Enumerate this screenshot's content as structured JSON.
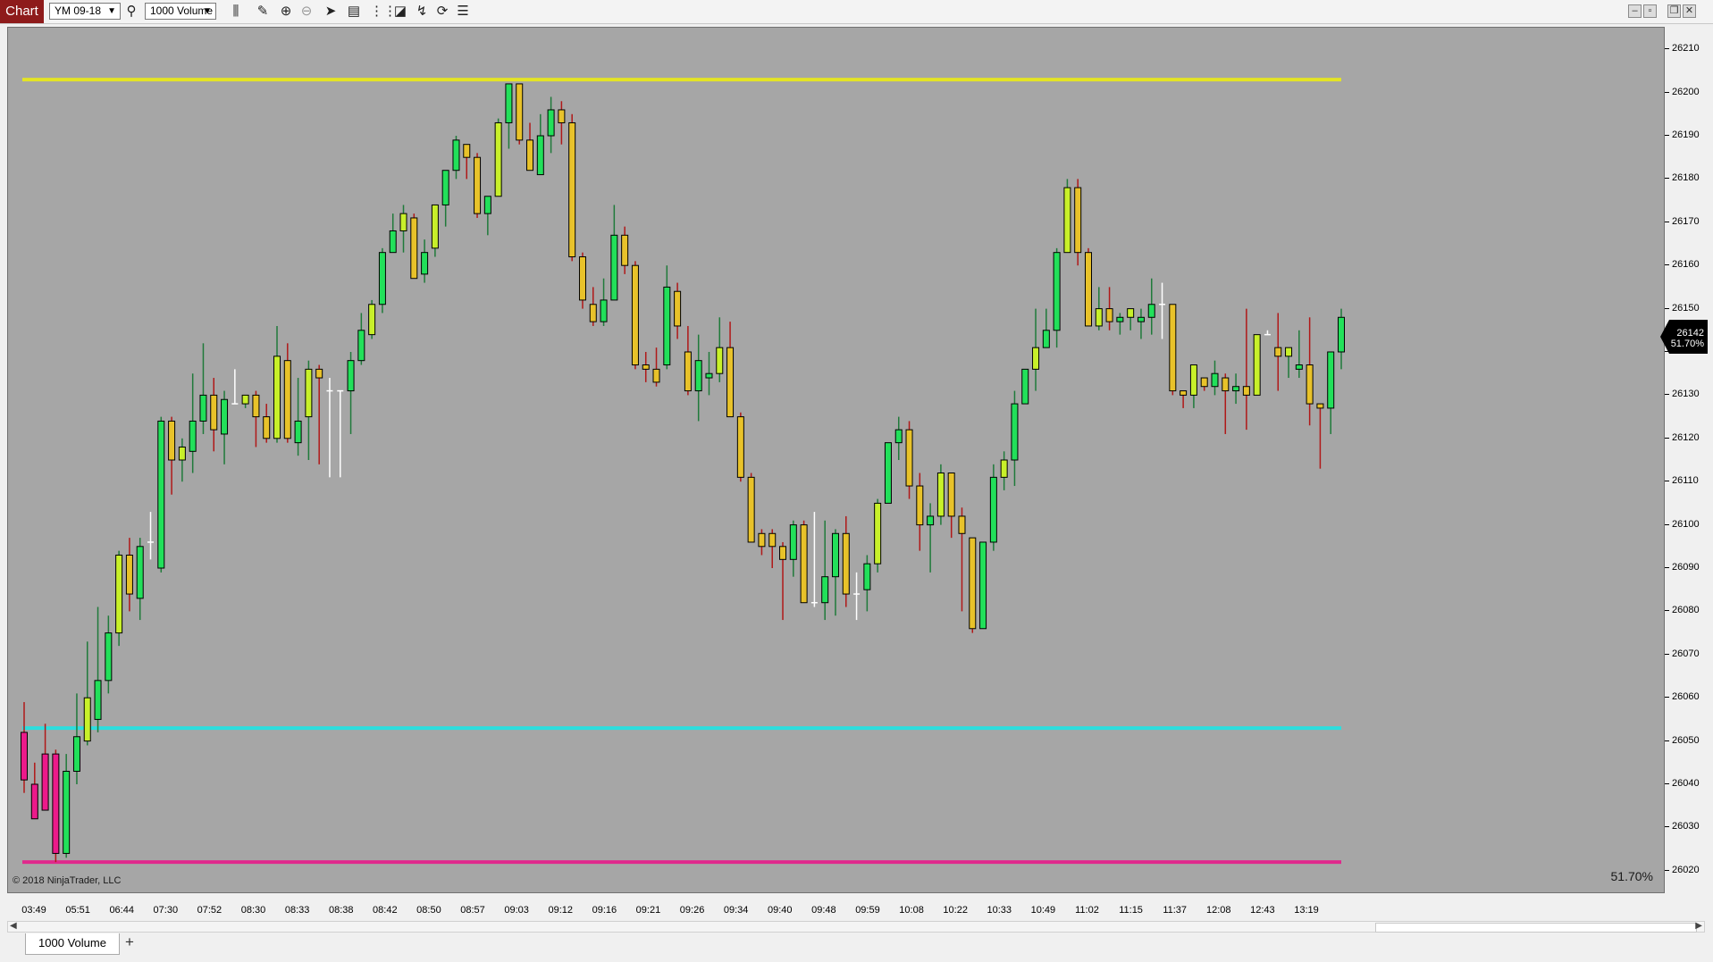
{
  "toolbar": {
    "chart_label": "Chart",
    "instrument": "YM 09-18",
    "period": "1000 Volume",
    "icons": [
      "magnify-icon",
      "bar-type-icon",
      "pencil-icon",
      "zoom-in-icon",
      "zoom-out-icon",
      "pointer-icon",
      "properties-icon",
      "columns-icon",
      "data-box-icon",
      "strategies-icon",
      "indicators-icon",
      "chart-trader-icon"
    ],
    "window_buttons": [
      "minimize-icon",
      "restore-icon",
      "maximize-icon",
      "close-icon"
    ]
  },
  "chart": {
    "copyright": "© 2018 NinjaTrader, LLC",
    "percent_label": "51.70%",
    "last_price": "26142",
    "last_percent": "51.70%",
    "colors": {
      "background": "#a6a6a6",
      "up_body": "#22e05a",
      "up_body_alt": "#c8f02a",
      "down_body": "#e8c22a",
      "down_body_alt": "#ec1a8a",
      "outline": "#000000",
      "wick_up": "#1f7a3a",
      "wick_down": "#b01818",
      "doji": "#ffffff",
      "resistance_line": "#e4e424",
      "support_line_1": "#2cdede",
      "support_line_2": "#e0288c"
    }
  },
  "chart_data": {
    "type": "candlestick",
    "ylim": [
      26015,
      26215
    ],
    "y_ticks": [
      26210,
      26200,
      26190,
      26180,
      26170,
      26160,
      26150,
      26140,
      26130,
      26120,
      26110,
      26100,
      26090,
      26080,
      26070,
      26060,
      26050,
      26040,
      26030,
      26020
    ],
    "x_ticks": [
      "03:49",
      "05:51",
      "06:44",
      "07:30",
      "07:52",
      "08:30",
      "08:33",
      "08:38",
      "08:42",
      "08:50",
      "08:57",
      "09:03",
      "09:12",
      "09:16",
      "09:21",
      "09:26",
      "09:34",
      "09:40",
      "09:48",
      "09:59",
      "10:08",
      "10:22",
      "10:33",
      "10:49",
      "11:02",
      "11:15",
      "11:37",
      "12:08",
      "12:43",
      "13:19"
    ],
    "horizontal_lines": [
      {
        "price": 26203,
        "color": "#e4e424"
      },
      {
        "price": 26053,
        "color": "#2cdede"
      },
      {
        "price": 26022,
        "color": "#e0288c"
      }
    ],
    "ohlc": [
      [
        26052,
        26059,
        26038,
        26041
      ],
      [
        26040,
        26045,
        26033,
        26032
      ],
      [
        26047,
        26054,
        26034,
        26034
      ],
      [
        26047,
        26048,
        26022,
        26024
      ],
      [
        26024,
        26047,
        26023,
        26043
      ],
      [
        26043,
        26061,
        26040,
        26051
      ],
      [
        26050,
        26073,
        26049,
        26060
      ],
      [
        26055,
        26081,
        26052,
        26064
      ],
      [
        26064,
        26079,
        26061,
        26075
      ],
      [
        26075,
        26094,
        26072,
        26093
      ],
      [
        26093,
        26097,
        26080,
        26084
      ],
      [
        26083,
        26097,
        26078,
        26095
      ],
      [
        26096,
        26103,
        26092,
        26096
      ],
      [
        26090,
        26125,
        26089,
        26124
      ],
      [
        26124,
        26125,
        26107,
        26115
      ],
      [
        26115,
        26120,
        26110,
        26118
      ],
      [
        26117,
        26135,
        26112,
        26124
      ],
      [
        26124,
        26142,
        26121,
        26130
      ],
      [
        26130,
        26134,
        26117,
        26122
      ],
      [
        26121,
        26131,
        26114,
        26129
      ],
      [
        26128,
        26136,
        26128,
        26128
      ],
      [
        26128,
        26129,
        26127,
        26130
      ],
      [
        26130,
        26131,
        26118,
        26125
      ],
      [
        26125,
        26128,
        26119,
        26120
      ],
      [
        26120,
        26146,
        26119,
        26139
      ],
      [
        26138,
        26142,
        26119,
        26120
      ],
      [
        26119,
        26134,
        26116,
        26124
      ],
      [
        26125,
        26138,
        26115,
        26136
      ],
      [
        26136,
        26137,
        26114,
        26134
      ],
      [
        26131,
        26134,
        26111,
        26131
      ],
      [
        26131,
        26131,
        26111,
        26131
      ],
      [
        26131,
        26140,
        26121,
        26138
      ],
      [
        26138,
        26149,
        26137,
        26145
      ],
      [
        26144,
        26152,
        26143,
        26151
      ],
      [
        26151,
        26164,
        26149,
        26163
      ],
      [
        26163,
        26172,
        26167,
        26168
      ],
      [
        26168,
        26174,
        26163,
        26172
      ],
      [
        26171,
        26172,
        26157,
        26157
      ],
      [
        26158,
        26166,
        26156,
        26163
      ],
      [
        26164,
        26174,
        26162,
        26174
      ],
      [
        26174,
        26180,
        26169,
        26182
      ],
      [
        26182,
        26190,
        26180,
        26189
      ],
      [
        26188,
        26188,
        26180,
        26185
      ],
      [
        26185,
        26186,
        26171,
        26172
      ],
      [
        26172,
        26176,
        26167,
        26176
      ],
      [
        26176,
        26194,
        26177,
        26193
      ],
      [
        26193,
        26202,
        26187,
        26202
      ],
      [
        26202,
        26202,
        26188,
        26189
      ],
      [
        26189,
        26193,
        26182,
        26182
      ],
      [
        26181,
        26195,
        26181,
        26190
      ],
      [
        26190,
        26199,
        26186,
        26196
      ],
      [
        26196,
        26198,
        26188,
        26193
      ],
      [
        26193,
        26195,
        26161,
        26162
      ],
      [
        26162,
        26163,
        26150,
        26152
      ],
      [
        26151,
        26155,
        26146,
        26147
      ],
      [
        26147,
        26157,
        26146,
        26152
      ],
      [
        26152,
        26174,
        26152,
        26167
      ],
      [
        26167,
        26169,
        26158,
        26160
      ],
      [
        26160,
        26161,
        26136,
        26137
      ],
      [
        26137,
        26140,
        26133,
        26136
      ],
      [
        26136,
        26141,
        26132,
        26133
      ],
      [
        26137,
        26160,
        26136,
        26155
      ],
      [
        26154,
        26156,
        26143,
        26146
      ],
      [
        26140,
        26146,
        26130,
        26131
      ],
      [
        26131,
        26144,
        26124,
        26138
      ],
      [
        26134,
        26140,
        26130,
        26135
      ],
      [
        26135,
        26148,
        26133,
        26141
      ],
      [
        26141,
        26147,
        26125,
        26125
      ],
      [
        26125,
        26126,
        26110,
        26111
      ],
      [
        26111,
        26112,
        26096,
        26096
      ],
      [
        26098,
        26099,
        26093,
        26095
      ],
      [
        26098,
        26099,
        26090,
        26095
      ],
      [
        26095,
        26096,
        26078,
        26092
      ],
      [
        26092,
        26101,
        26088,
        26100
      ],
      [
        26100,
        26101,
        26084,
        26082
      ],
      [
        26082,
        26103,
        26081,
        26082
      ],
      [
        26082,
        26101,
        26078,
        26088
      ],
      [
        26088,
        26099,
        26079,
        26098
      ],
      [
        26098,
        26102,
        26081,
        26084
      ],
      [
        26084,
        26089,
        26078,
        26084
      ],
      [
        26085,
        26093,
        26080,
        26091
      ],
      [
        26091,
        26106,
        26089,
        26105
      ],
      [
        26105,
        26119,
        26105,
        26119
      ],
      [
        26119,
        26125,
        26115,
        26122
      ],
      [
        26122,
        26124,
        26106,
        26109
      ],
      [
        26109,
        26112,
        26094,
        26100
      ],
      [
        26100,
        26105,
        26089,
        26102
      ],
      [
        26102,
        26114,
        26100,
        26112
      ],
      [
        26112,
        26112,
        26097,
        26102
      ],
      [
        26102,
        26104,
        26080,
        26098
      ],
      [
        26097,
        26097,
        26075,
        26076
      ],
      [
        26076,
        26096,
        26076,
        26096
      ],
      [
        26096,
        26114,
        26094,
        26111
      ],
      [
        26111,
        26117,
        26108,
        26115
      ],
      [
        26115,
        26131,
        26109,
        26128
      ],
      [
        26128,
        26136,
        26128,
        26136
      ],
      [
        26136,
        26150,
        26131,
        26141
      ],
      [
        26141,
        26150,
        26141,
        26145
      ],
      [
        26145,
        26164,
        26141,
        26163
      ],
      [
        26163,
        26180,
        26163,
        26178
      ],
      [
        26178,
        26180,
        26160,
        26163
      ],
      [
        26163,
        26164,
        26146,
        26146
      ],
      [
        26146,
        26155,
        26145,
        26150
      ],
      [
        26150,
        26155,
        26145,
        26147
      ],
      [
        26147,
        26149,
        26144,
        26148
      ],
      [
        26148,
        26150,
        26145,
        26150
      ],
      [
        26147,
        26150,
        26143,
        26148
      ],
      [
        26148,
        26157,
        26144,
        26151
      ],
      [
        26151,
        26156,
        26143,
        26151
      ],
      [
        26151,
        26150,
        26130,
        26131
      ],
      [
        26131,
        26131,
        26127,
        26130
      ],
      [
        26130,
        26136,
        26127,
        26137
      ],
      [
        26134,
        26131,
        26131,
        26132
      ],
      [
        26132,
        26138,
        26130,
        26135
      ],
      [
        26134,
        26135,
        26121,
        26131
      ],
      [
        26131,
        26135,
        26128,
        26132
      ],
      [
        26132,
        26150,
        26122,
        26130
      ],
      [
        26130,
        26141,
        26130,
        26144
      ],
      [
        26144,
        26145,
        26144,
        26144
      ],
      [
        26141,
        26149,
        26131,
        26139
      ],
      [
        26139,
        26139,
        26134,
        26141
      ],
      [
        26136,
        26145,
        26134,
        26137
      ],
      [
        26137,
        26148,
        26123,
        26128
      ],
      [
        26128,
        26128,
        26113,
        26127
      ],
      [
        26127,
        26140,
        26121,
        26140
      ],
      [
        26140,
        26150,
        26136,
        26148
      ]
    ]
  },
  "tabs": {
    "active": "1000 Volume",
    "add": "+"
  }
}
